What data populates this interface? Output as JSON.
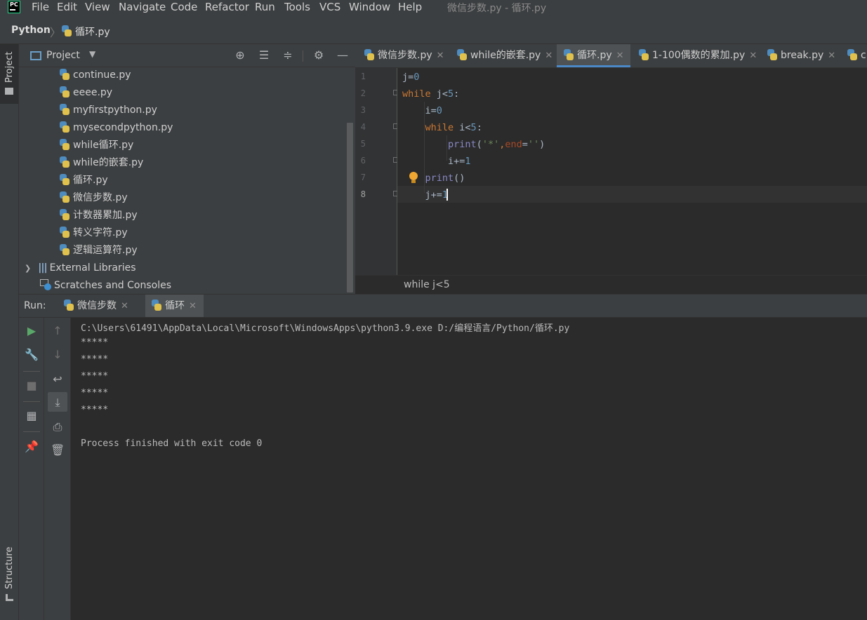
{
  "menu": [
    "File",
    "Edit",
    "View",
    "Navigate",
    "Code",
    "Refactor",
    "Run",
    "Tools",
    "VCS",
    "Window",
    "Help"
  ],
  "window_title": "微信步数.py - 循环.py",
  "breadcrumb": {
    "project": "Python",
    "file": "循环.py"
  },
  "left_strip": {
    "project_label": "Project",
    "structure_label": "Structure"
  },
  "project_panel": {
    "title": "Project",
    "files": [
      "continue.py",
      "eeee.py",
      "myfirstpython.py",
      "mysecondpython.py",
      "while循环.py",
      "while的嵌套.py",
      "循环.py",
      "微信步数.py",
      "计数器累加.py",
      "转义字符.py",
      "逻辑运算符.py"
    ],
    "external_libraries": "External Libraries",
    "scratches": "Scratches and Consoles"
  },
  "editor_tabs": [
    {
      "label": "微信步数.py",
      "selected": false
    },
    {
      "label": "while的嵌套.py",
      "selected": false
    },
    {
      "label": "循环.py",
      "selected": true
    },
    {
      "label": "1-100偶数的累加.py",
      "selected": false
    },
    {
      "label": "break.py",
      "selected": false
    },
    {
      "label": "c",
      "selected": false
    }
  ],
  "line_numbers": [
    "1",
    "2",
    "3",
    "4",
    "5",
    "6",
    "7",
    "8"
  ],
  "code_breadcrumb": "while j<5",
  "run": {
    "label": "Run:",
    "tabs": [
      {
        "label": "微信步数"
      },
      {
        "label": "循环"
      }
    ],
    "output": [
      "C:\\Users\\61491\\AppData\\Local\\Microsoft\\WindowsApps\\python3.9.exe D:/编程语言/Python/循环.py",
      "*****",
      "*****",
      "*****",
      "*****",
      "*****",
      "",
      "Process finished with exit code 0"
    ]
  },
  "colors": {
    "accent": "#4a88c7",
    "keyword": "#cc7832",
    "number": "#6897bb",
    "string": "#6a8759",
    "builtin": "#8888c6"
  }
}
